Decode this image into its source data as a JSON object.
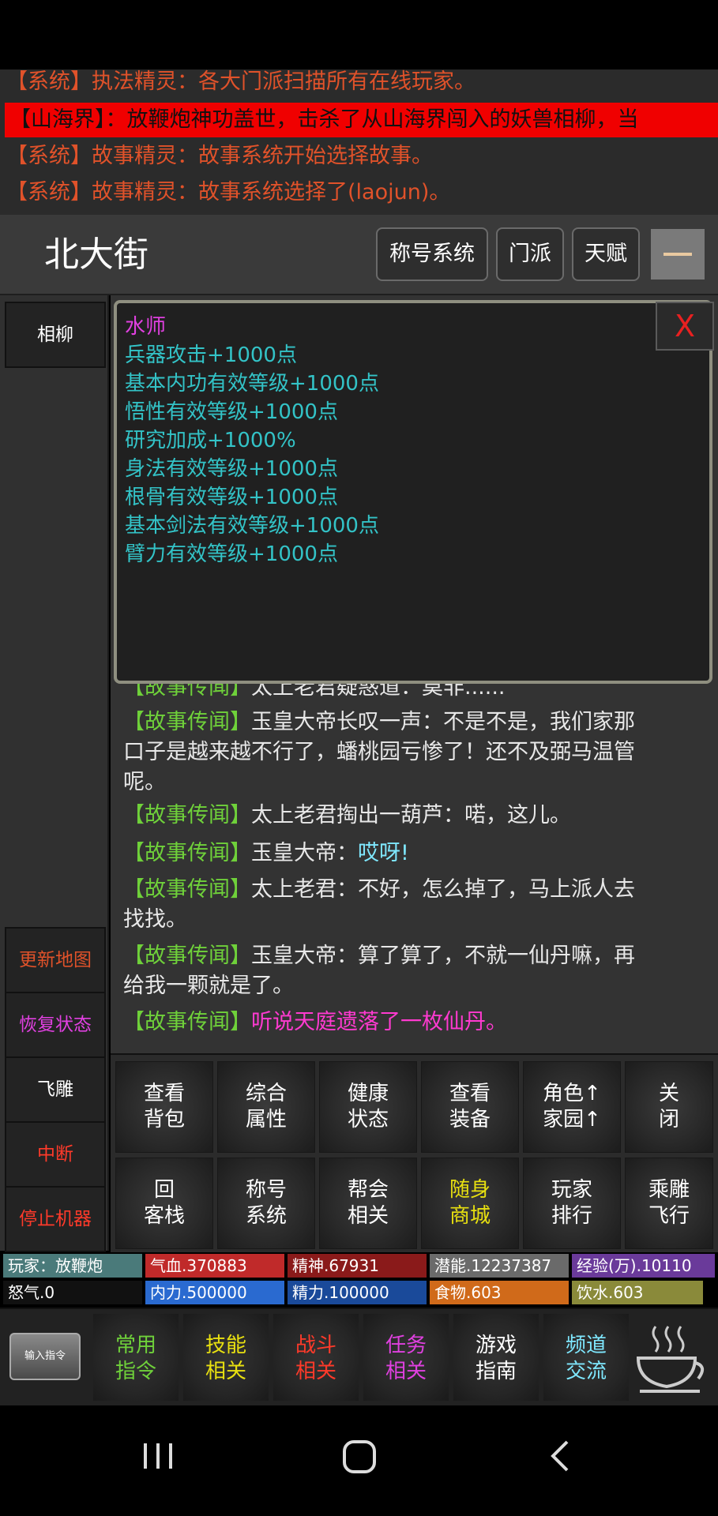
{
  "system_messages": [
    "【系统】执法精灵：各大门派扫描所有在线玩家。",
    "【山海界】：放鞭炮神功盖世，击杀了从山海界闯入的妖兽相柳，当",
    "【系统】故事精灵：故事系统开始选择故事。",
    "【系统】故事精灵：故事系统选择了(laojun)。"
  ],
  "header": {
    "location": "北大街",
    "buttons": [
      "称号系统",
      "门派",
      "天赋"
    ],
    "minimize_label": "—"
  },
  "left_column": {
    "top_item": "相柳",
    "actions": [
      "更新地图",
      "恢复状态",
      "飞雕",
      "中断",
      "停止机器"
    ],
    "action_colors": [
      "#e0522a",
      "#e040e0",
      "#ffffff",
      "#ff3a2a",
      "#ff3a2a"
    ]
  },
  "popup": {
    "title": "水师",
    "lines": [
      "兵器攻击+1000点",
      "基本内功有效等级+1000点",
      "悟性有效等级+1000点",
      "研究加成+1000%",
      "身法有效等级+1000点",
      "根骨有效等级+1000点",
      "基本剑法有效等级+1000点",
      "臂力有效等级+1000点"
    ],
    "close_label": "X"
  },
  "story": {
    "tag": "【故事传闻】",
    "partial_top": "太上老君疑惑道：莫非......",
    "l1a": "玉皇大帝长叹一声：不是不是，我们家那",
    "l1b": "口子是越来越不行了，蟠桃园亏惨了！还不及弼马温管",
    "l1c": "呢。",
    "l2": "太上老君掏出一葫芦：喏，这儿。",
    "l3a": "玉皇大帝：",
    "l3b": "哎呀!",
    "l4a": "太上老君：不好，怎么掉了，马上派人去",
    "l4b": "找找。",
    "l5a": "玉皇大帝：算了算了，不就一仙丹嘛，再",
    "l5b": "给我一颗就是了。",
    "l6": "听说天庭遗落了一枚仙丹。"
  },
  "grid": {
    "row1": [
      [
        "查看",
        "背包"
      ],
      [
        "综合",
        "属性"
      ],
      [
        "健康",
        "状态"
      ],
      [
        "查看",
        "装备"
      ],
      [
        "角色↑",
        "家园↑"
      ],
      [
        "关",
        "闭"
      ]
    ],
    "row2": [
      [
        "回",
        "客栈"
      ],
      [
        "称号",
        "系统"
      ],
      [
        "帮会",
        "相关"
      ],
      [
        "随身",
        "商城"
      ],
      [
        "玩家",
        "排行"
      ],
      [
        "乘雕",
        "飞行"
      ]
    ]
  },
  "stats": {
    "player": "玩家：放鞭炮",
    "qixue": "气血.370883",
    "jingshen": "精神.67931",
    "qianneng": "潜能.12237387",
    "jingyan": "经验(万).10110",
    "nuqi": "怒气.0",
    "neili": "内力.500000",
    "jingli": "精力.100000",
    "shiwu": "食物.603",
    "yinshui": "饮水.603"
  },
  "bottom": {
    "input_label": "输入指令",
    "tabs": [
      [
        "常用",
        "指令"
      ],
      [
        "技能",
        "相关"
      ],
      [
        "战斗",
        "相关"
      ],
      [
        "任务",
        "相关"
      ],
      [
        "游戏",
        "指南"
      ],
      [
        "频道",
        "交流"
      ]
    ],
    "tab_colors": [
      "#6fd13a",
      "#e8e010",
      "#ff3a2a",
      "#e040e0",
      "#ffffff",
      "#7fe8ff"
    ]
  },
  "nav": {
    "icons": [
      "recent-apps-icon",
      "home-icon",
      "back-icon"
    ]
  }
}
